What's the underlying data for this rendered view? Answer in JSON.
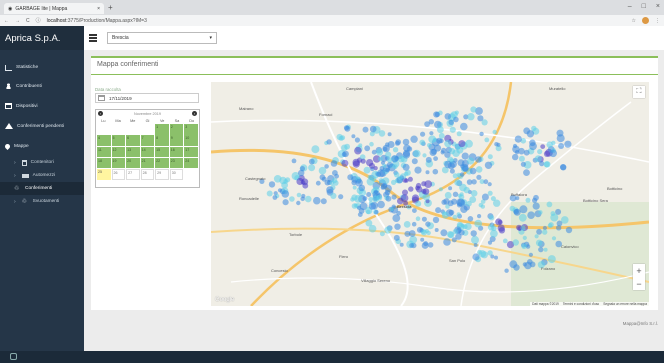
{
  "browser": {
    "tab_title": "GARBAGE lite | Mappa",
    "url_host": "localhost",
    "url_rest": ":3775/Production/Mappa.aspx?IM=3"
  },
  "sidebar": {
    "brand": "Aprica S.p.A.",
    "items": [
      {
        "label": "Statistiche",
        "icon": "chart-icon"
      },
      {
        "label": "Contribuenti",
        "icon": "user-icon"
      },
      {
        "label": "Dispositivi",
        "icon": "card-icon"
      },
      {
        "label": "Conferimenti pendenti",
        "icon": "warning-icon"
      },
      {
        "label": "Mappe",
        "icon": "map-pin-icon"
      }
    ],
    "subitems": [
      {
        "label": "Contenitori",
        "icon": "bin-icon"
      },
      {
        "label": "Automezzi",
        "icon": "truck-icon"
      },
      {
        "label": "Conferimenti",
        "icon": "recycle-icon"
      },
      {
        "label": "Svuotamenti",
        "icon": "recycle-icon"
      }
    ]
  },
  "header": {
    "city_select": "Brescia"
  },
  "panel": {
    "title": "Mappa conferimenti",
    "date_label": "Data raccolta",
    "date_value": "17/11/2019"
  },
  "calendar": {
    "month": "Novembre 2019",
    "prev": "‹",
    "next": "›",
    "dows": [
      "Lu",
      "Ma",
      "Me",
      "Gi",
      "Ve",
      "Sa",
      "Do"
    ],
    "leading_blank": 4,
    "days": [
      1,
      2,
      3,
      4,
      5,
      6,
      7,
      8,
      9,
      10,
      11,
      12,
      13,
      14,
      15,
      16,
      17,
      18,
      19,
      20,
      21,
      22,
      23,
      24,
      25,
      26,
      27,
      28,
      29,
      30
    ],
    "selected_up_to": 24,
    "today": 25
  },
  "map": {
    "labels": {
      "campiani": "Campiani",
      "muratello": "Muratello",
      "mairano": "Mairano",
      "fornaci": "Fornaci",
      "folzano": "Folzano",
      "buffalora": "Buffalora",
      "caionvico": "Caionvico",
      "botticino": "Botticino Sera",
      "botticino2": "Botticino",
      "roncadelle": "Roncadelle",
      "castegnato": "Castegnato",
      "torbole": "Torbole",
      "villaggio": "Villaggio Sereno",
      "concesio": "Concesio",
      "sanpolo": "San Polo",
      "brescia": "Brescia",
      "flero": "Flero"
    },
    "zoom_in": "+",
    "zoom_out": "−",
    "fullscreen": "⛶",
    "google": "Google",
    "attribution": [
      "Dati mappa ©2019",
      "Termini e condizioni d'uso",
      "Segnala un errore nella mappa"
    ],
    "heat_colors": {
      "low": "#5fd0e8",
      "mid": "#3a8be0",
      "high": "#4a3dc8"
    }
  },
  "footer": "Mappa@Info S.r.l."
}
